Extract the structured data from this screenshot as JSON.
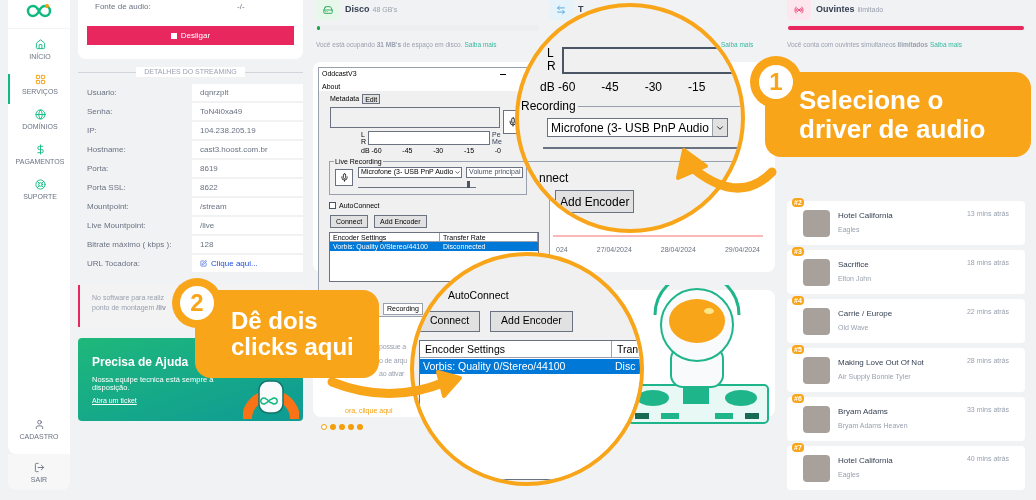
{
  "sidebar": {
    "items": [
      {
        "label": "INÍCIO",
        "selected": false
      },
      {
        "label": "SERVIÇOS",
        "selected": true
      },
      {
        "label": "DOMÍNIOS",
        "selected": false
      },
      {
        "label": "PAGAMENTOS",
        "selected": false
      },
      {
        "label": "SUPORTE",
        "selected": false
      }
    ],
    "bottom_items": [
      {
        "label": "CADASTRO"
      },
      {
        "label": "SAIR"
      }
    ]
  },
  "source_card": {
    "label": "Fonte de audio:",
    "value": "-/-",
    "button": "Desligar"
  },
  "streaming_details": {
    "heading": "DETALHES DO STREAMING",
    "rows": [
      {
        "label": "Usuario:",
        "value": "dqnrzplt",
        "kind": "text"
      },
      {
        "label": "Senha:",
        "value": "ToN4i0xa49",
        "kind": "text"
      },
      {
        "label": "IP:",
        "value": "104.238.205.19",
        "kind": "text"
      },
      {
        "label": "Hostname:",
        "value": "cast3.hoost.com.br",
        "kind": "text"
      },
      {
        "label": "Porta:",
        "value": "8619",
        "kind": "text"
      },
      {
        "label": "Porta SSL:",
        "value": "8622",
        "kind": "text"
      },
      {
        "label": "Mountpoint:",
        "value": "/stream",
        "kind": "text"
      },
      {
        "label": "Live Mountpoint:",
        "value": "/live",
        "kind": "text"
      },
      {
        "label": "Bitrate máximo ( kbps ):",
        "value": "128",
        "kind": "text"
      },
      {
        "label": "URL Tocadora:",
        "value": "Clique aqui...",
        "kind": "link"
      }
    ]
  },
  "notice": {
    "lines": [
      "No software para realiz",
      "ponto de montagem **/liv**"
    ]
  },
  "help_card": {
    "title": "Precisa de Ajuda",
    "text": "Nossa equipe tecnica está sempre a disposição.",
    "link": "Abra um ticket"
  },
  "disk": {
    "title": "Disco",
    "subtitle": "48 GB's",
    "level": 0.01,
    "note": "Você está ocupando **31 MB's** de espaço em disco.",
    "link": "Saiba mais"
  },
  "transfer": {
    "title": "T",
    "link": "Saiba mais"
  },
  "chart": {
    "axis_labels": [
      "024",
      "27/04/2024",
      "28/04/2024",
      "29/04/2024"
    ]
  },
  "listeners": {
    "title": "Ouvintes",
    "subtitle": "ilimitado",
    "level": 1,
    "note": "Você conta com ouvintes simultaneos **ilimitados**",
    "link": "Saiba mais"
  },
  "songs": [
    {
      "rank": "#2",
      "title": "Hotel California",
      "artist": "Eagles",
      "time": "13 mins atrás"
    },
    {
      "rank": "#3",
      "title": "Sacrifice",
      "artist": "Elton John",
      "time": "18 mins atrás"
    },
    {
      "rank": "#4",
      "title": "Carrie / Europe",
      "artist": "Old Wave",
      "time": "22 mins atrás"
    },
    {
      "rank": "#5",
      "title": "Making Love Out Of Not",
      "artist": "Air Supply Bonnie Tyler",
      "time": "28 mins atrás"
    },
    {
      "rank": "#6",
      "title": "Bryam Adams",
      "artist": "Bryam Adams Heaven",
      "time": "33 mins atrás"
    },
    {
      "rank": "#7",
      "title": "Hotel California",
      "artist": "Eagles",
      "time": "40 mins atrás"
    }
  ],
  "slider": {
    "fragments": [
      "possue a",
      "o de arqu",
      "ao ativar"
    ],
    "link": "ora, clique aqui",
    "dots": [
      {
        "selected": true
      },
      {
        "selected": false
      },
      {
        "selected": false
      },
      {
        "selected": false
      },
      {
        "selected": false
      }
    ]
  },
  "oddcast": {
    "title": "OddcastV3",
    "menu": "About",
    "metadata_label": "Metadata",
    "edit_button": "Edit",
    "meter_labels": [
      "L",
      "R"
    ],
    "db_scale": [
      "dB -60",
      "-45",
      "-30",
      "-15",
      "-0"
    ],
    "side_labels": [
      "Pe",
      "Me"
    ],
    "group_label": "Live Recording",
    "device": "Microfone (3- USB PnP Audio",
    "mixer": "Volume principal",
    "volume_slider": {
      "level": 0.95
    },
    "autoconnect": {
      "label": "AutoConnect",
      "checked": false
    },
    "buttons": [
      "Connect",
      "Add Encoder"
    ],
    "columns": [
      "Encoder Settings",
      "Transfer Rate"
    ],
    "rows": [
      {
        "encoder": "Vorbis: Quality 0/Stereo/44100",
        "rate": "Disconnected",
        "selected": true
      }
    ],
    "tab": "Recording"
  },
  "magnifier_1": {
    "meter_labels": [
      "L",
      "R"
    ],
    "db_scale": [
      "dB -60",
      "-45",
      "-30",
      "-15"
    ],
    "group_label": "Recording",
    "device": "Microfone (3- USB PnP Audio",
    "connect_fragment": "nnect",
    "button": "Add Encoder"
  },
  "magnifier_2": {
    "autoconnect": "AutoConnect",
    "buttons": [
      "Connect",
      "Add Encoder"
    ],
    "columns": [
      "Encoder Settings",
      "Tran"
    ],
    "rows": [
      {
        "encoder": "Vorbis: Quality 0/Stereo/44100",
        "rate": "Disc",
        "selected": true
      }
    ]
  },
  "callouts": [
    {
      "number": "1",
      "text": "Selecione o driver de audio"
    },
    {
      "number": "2",
      "text": "Dê dois clicks aqui"
    }
  ]
}
